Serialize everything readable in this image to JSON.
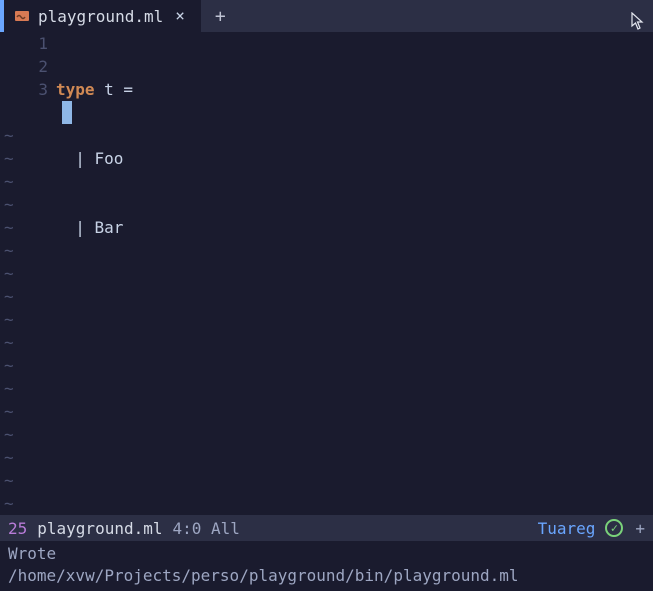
{
  "tab": {
    "filename": "playground.ml",
    "close": "×",
    "add": "+"
  },
  "code": {
    "lines": [
      {
        "n": "1",
        "pre": "",
        "kw": "type",
        "rest": " t ="
      },
      {
        "n": "2",
        "pre": "  | Foo",
        "kw": "",
        "rest": ""
      },
      {
        "n": "3",
        "pre": "  | Bar",
        "kw": "",
        "rest": ""
      }
    ]
  },
  "modeline": {
    "diff": "25",
    "filename": "playground.ml",
    "position": "4:0 All",
    "mode": "Tuareg",
    "check": "✓",
    "plus": "+"
  },
  "minibuffer": {
    "line1": "Wrote",
    "line2": "/home/xvw/Projects/perso/playground/bin/playground.ml"
  }
}
